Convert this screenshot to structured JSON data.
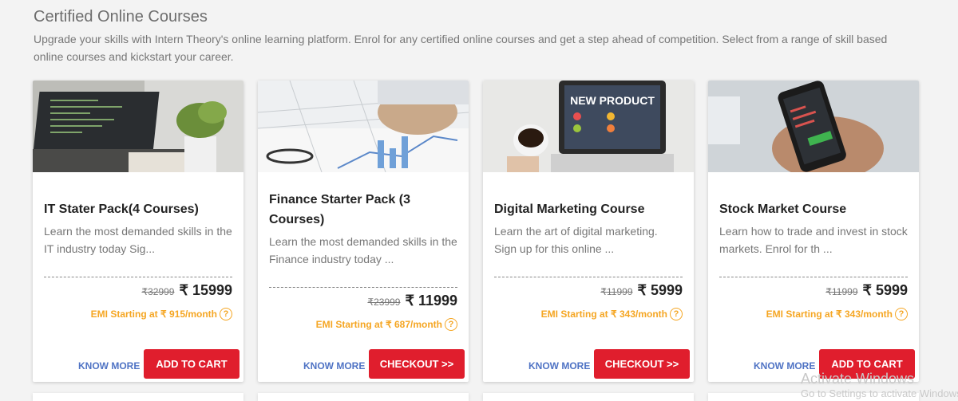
{
  "header": {
    "title": "Certified Online Courses",
    "subtitle": "Upgrade your skills with Intern Theory's online learning platform. Enrol for any certified online courses and get a step ahead of competition. Select from a range of skill based online courses and kickstart your career."
  },
  "cards": [
    {
      "title": "IT Stater Pack(4 Courses)",
      "description": "Learn the most demanded skills in the IT industry today Sig...",
      "old_price": "₹32999",
      "new_price": "₹ 15999",
      "emi": "EMI Starting at ₹ 915/month",
      "know_more": "KNOW MORE",
      "cta": "ADD TO CART"
    },
    {
      "title": "Finance Starter Pack (3 Courses)",
      "description": "Learn the most demanded skills in the Finance industry today ...",
      "old_price": "₹23999",
      "new_price": "₹ 11999",
      "emi": "EMI Starting at ₹ 687/month",
      "know_more": "KNOW MORE",
      "cta": "CHECKOUT >>"
    },
    {
      "title": "Digital Marketing Course",
      "description": "Learn the art of digital marketing. Sign up for this online ...",
      "old_price": "₹11999",
      "new_price": "₹ 5999",
      "emi": "EMI Starting at ₹ 343/month",
      "know_more": "KNOW MORE",
      "cta": "CHECKOUT >>",
      "image_text": "NEW PRODUCT"
    },
    {
      "title": "Stock Market Course",
      "description": "Learn how to trade and invest in stock markets. Enrol for th ...",
      "old_price": "₹11999",
      "new_price": "₹ 5999",
      "emi": "EMI Starting at ₹ 343/month",
      "know_more": "KNOW MORE",
      "cta": "ADD TO CART"
    }
  ],
  "help_symbol": "?",
  "watermark": {
    "line1": "Activate Windows",
    "line2": "Go to Settings to activate Windows."
  },
  "colors": {
    "accent": "#e01e2d",
    "emi": "#f5a623",
    "link": "#4f73c4"
  }
}
